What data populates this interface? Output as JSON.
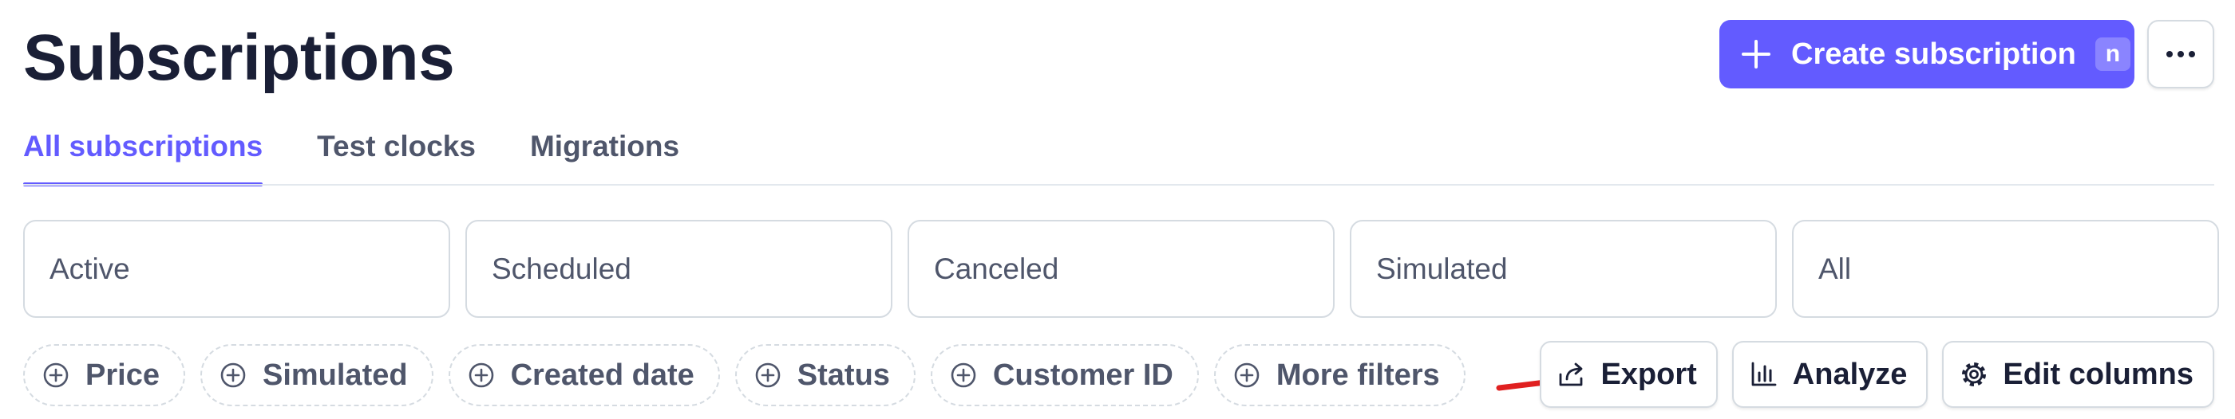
{
  "page": {
    "title": "Subscriptions"
  },
  "header": {
    "create_button": {
      "label": "Create subscription",
      "shortcut": "n"
    },
    "more_button": {
      "label": "…"
    }
  },
  "tabs": [
    {
      "label": "All subscriptions",
      "active": true
    },
    {
      "label": "Test clocks",
      "active": false
    },
    {
      "label": "Migrations",
      "active": false
    }
  ],
  "status_filters": [
    {
      "label": "Active"
    },
    {
      "label": "Scheduled"
    },
    {
      "label": "Canceled"
    },
    {
      "label": "Simulated"
    },
    {
      "label": "All"
    }
  ],
  "filter_chips": [
    {
      "label": "Price"
    },
    {
      "label": "Simulated"
    },
    {
      "label": "Created date"
    },
    {
      "label": "Status"
    },
    {
      "label": "Customer ID"
    },
    {
      "label": "More filters"
    }
  ],
  "actions": {
    "export": {
      "label": "Export",
      "icon": "export-icon"
    },
    "analyze": {
      "label": "Analyze",
      "icon": "bar-chart-icon"
    },
    "edit_columns": {
      "label": "Edit columns",
      "icon": "gear-icon"
    }
  },
  "colors": {
    "accent": "#635bff",
    "text": "#1a1f36",
    "muted": "#4f566b",
    "border": "#d5dbe1",
    "annotation_arrow": "#e02020"
  }
}
